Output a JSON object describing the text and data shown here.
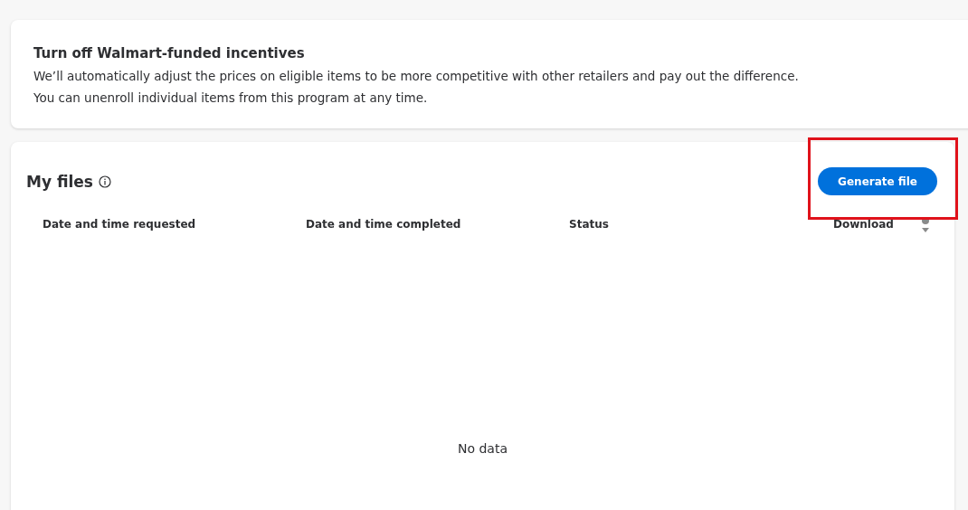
{
  "notice": {
    "title": "Turn off Walmart-funded incentives",
    "lines": [
      "We’ll automatically adjust the prices on eligible items to be more competitive with other retailers and pay out the difference.",
      "You can unenroll individual items from this program at any time."
    ]
  },
  "files": {
    "title": "My files",
    "button": "Generate file",
    "table": {
      "columns": [
        "Date and time requested",
        "Date and time completed",
        "Status",
        "Download"
      ],
      "empty": "No data"
    }
  }
}
